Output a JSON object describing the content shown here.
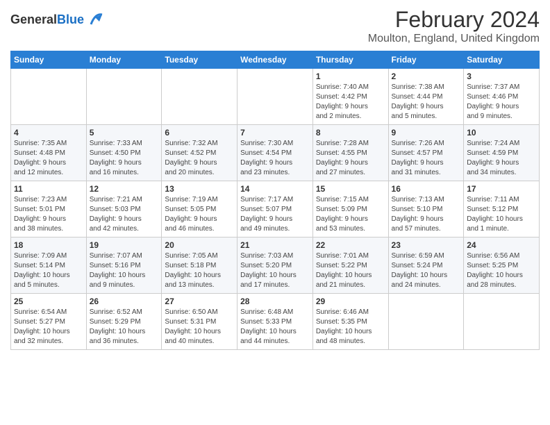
{
  "header": {
    "logo_line1": "General",
    "logo_line2": "Blue",
    "title": "February 2024",
    "subtitle": "Moulton, England, United Kingdom"
  },
  "days_of_week": [
    "Sunday",
    "Monday",
    "Tuesday",
    "Wednesday",
    "Thursday",
    "Friday",
    "Saturday"
  ],
  "weeks": [
    [
      {
        "day": "",
        "info": ""
      },
      {
        "day": "",
        "info": ""
      },
      {
        "day": "",
        "info": ""
      },
      {
        "day": "",
        "info": ""
      },
      {
        "day": "1",
        "info": "Sunrise: 7:40 AM\nSunset: 4:42 PM\nDaylight: 9 hours\nand 2 minutes."
      },
      {
        "day": "2",
        "info": "Sunrise: 7:38 AM\nSunset: 4:44 PM\nDaylight: 9 hours\nand 5 minutes."
      },
      {
        "day": "3",
        "info": "Sunrise: 7:37 AM\nSunset: 4:46 PM\nDaylight: 9 hours\nand 9 minutes."
      }
    ],
    [
      {
        "day": "4",
        "info": "Sunrise: 7:35 AM\nSunset: 4:48 PM\nDaylight: 9 hours\nand 12 minutes."
      },
      {
        "day": "5",
        "info": "Sunrise: 7:33 AM\nSunset: 4:50 PM\nDaylight: 9 hours\nand 16 minutes."
      },
      {
        "day": "6",
        "info": "Sunrise: 7:32 AM\nSunset: 4:52 PM\nDaylight: 9 hours\nand 20 minutes."
      },
      {
        "day": "7",
        "info": "Sunrise: 7:30 AM\nSunset: 4:54 PM\nDaylight: 9 hours\nand 23 minutes."
      },
      {
        "day": "8",
        "info": "Sunrise: 7:28 AM\nSunset: 4:55 PM\nDaylight: 9 hours\nand 27 minutes."
      },
      {
        "day": "9",
        "info": "Sunrise: 7:26 AM\nSunset: 4:57 PM\nDaylight: 9 hours\nand 31 minutes."
      },
      {
        "day": "10",
        "info": "Sunrise: 7:24 AM\nSunset: 4:59 PM\nDaylight: 9 hours\nand 34 minutes."
      }
    ],
    [
      {
        "day": "11",
        "info": "Sunrise: 7:23 AM\nSunset: 5:01 PM\nDaylight: 9 hours\nand 38 minutes."
      },
      {
        "day": "12",
        "info": "Sunrise: 7:21 AM\nSunset: 5:03 PM\nDaylight: 9 hours\nand 42 minutes."
      },
      {
        "day": "13",
        "info": "Sunrise: 7:19 AM\nSunset: 5:05 PM\nDaylight: 9 hours\nand 46 minutes."
      },
      {
        "day": "14",
        "info": "Sunrise: 7:17 AM\nSunset: 5:07 PM\nDaylight: 9 hours\nand 49 minutes."
      },
      {
        "day": "15",
        "info": "Sunrise: 7:15 AM\nSunset: 5:09 PM\nDaylight: 9 hours\nand 53 minutes."
      },
      {
        "day": "16",
        "info": "Sunrise: 7:13 AM\nSunset: 5:10 PM\nDaylight: 9 hours\nand 57 minutes."
      },
      {
        "day": "17",
        "info": "Sunrise: 7:11 AM\nSunset: 5:12 PM\nDaylight: 10 hours\nand 1 minute."
      }
    ],
    [
      {
        "day": "18",
        "info": "Sunrise: 7:09 AM\nSunset: 5:14 PM\nDaylight: 10 hours\nand 5 minutes."
      },
      {
        "day": "19",
        "info": "Sunrise: 7:07 AM\nSunset: 5:16 PM\nDaylight: 10 hours\nand 9 minutes."
      },
      {
        "day": "20",
        "info": "Sunrise: 7:05 AM\nSunset: 5:18 PM\nDaylight: 10 hours\nand 13 minutes."
      },
      {
        "day": "21",
        "info": "Sunrise: 7:03 AM\nSunset: 5:20 PM\nDaylight: 10 hours\nand 17 minutes."
      },
      {
        "day": "22",
        "info": "Sunrise: 7:01 AM\nSunset: 5:22 PM\nDaylight: 10 hours\nand 21 minutes."
      },
      {
        "day": "23",
        "info": "Sunrise: 6:59 AM\nSunset: 5:24 PM\nDaylight: 10 hours\nand 24 minutes."
      },
      {
        "day": "24",
        "info": "Sunrise: 6:56 AM\nSunset: 5:25 PM\nDaylight: 10 hours\nand 28 minutes."
      }
    ],
    [
      {
        "day": "25",
        "info": "Sunrise: 6:54 AM\nSunset: 5:27 PM\nDaylight: 10 hours\nand 32 minutes."
      },
      {
        "day": "26",
        "info": "Sunrise: 6:52 AM\nSunset: 5:29 PM\nDaylight: 10 hours\nand 36 minutes."
      },
      {
        "day": "27",
        "info": "Sunrise: 6:50 AM\nSunset: 5:31 PM\nDaylight: 10 hours\nand 40 minutes."
      },
      {
        "day": "28",
        "info": "Sunrise: 6:48 AM\nSunset: 5:33 PM\nDaylight: 10 hours\nand 44 minutes."
      },
      {
        "day": "29",
        "info": "Sunrise: 6:46 AM\nSunset: 5:35 PM\nDaylight: 10 hours\nand 48 minutes."
      },
      {
        "day": "",
        "info": ""
      },
      {
        "day": "",
        "info": ""
      }
    ]
  ]
}
